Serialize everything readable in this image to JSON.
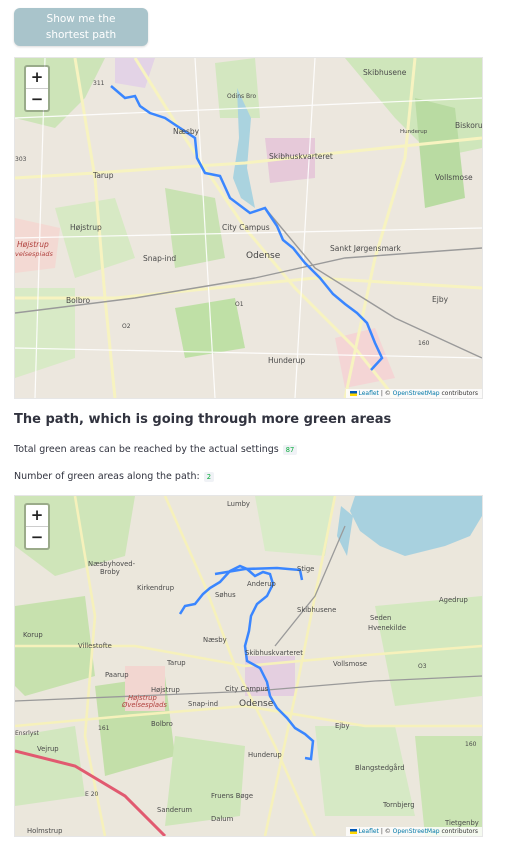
{
  "button": {
    "label": "Show me the shortest path"
  },
  "section": {
    "title": "The path, which is going through more green areas",
    "total_label": "Total green areas can be reached by the actual settings",
    "total_value": "87",
    "along_label": "Number of green areas along the path:",
    "along_value": "2"
  },
  "map_controls": {
    "zoom_in": "+",
    "zoom_out": "−"
  },
  "attribution": {
    "leaflet": "Leaflet",
    "sep": " | © ",
    "osm": "OpenStreetMap",
    "tail": " contributors"
  },
  "map1": {
    "labels": [
      "Skibhusene",
      "Biskorup",
      "Hunderup",
      "Odins Bro",
      "Næsby",
      "Skibhuskvarteret",
      "Vollsmose",
      "Tarup",
      "Højstrup",
      "Højstrup",
      "velsespiads",
      "City Campus",
      "Sankt Jørgensmark",
      "Snap-ind",
      "Odense",
      "Bolbro",
      "Ejby",
      "Hunderup",
      "311",
      "303",
      "O1",
      "O2",
      "160",
      "O1"
    ],
    "route_color": "#3a86ff"
  },
  "map2": {
    "labels": [
      "Lumby",
      "Næsbyhoved-Broby",
      "Kirkendrup",
      "Anderup",
      "Stige",
      "Søhus",
      "Skibhusene",
      "Seden",
      "Agedrup",
      "Hvenekilde",
      "Korup",
      "Villestofte",
      "Næsby",
      "Skibhuskvarteret",
      "Vollsmose",
      "Tarup",
      "Paarup",
      "Højstrup",
      "Øvelsesplads",
      "City Campus",
      "Snap-ind",
      "Odense",
      "Bolbro",
      "Ejby",
      "Vejrup",
      "Hunderup",
      "Blangstedgård",
      "Fruens Bøge",
      "Tornbjerg",
      "Sanderum",
      "Dalum",
      "Tietgenby",
      "Holmstrup",
      "E 20",
      "161",
      "160",
      "O3",
      "Ensrlyst"
    ],
    "route_color": "#3a86ff"
  }
}
